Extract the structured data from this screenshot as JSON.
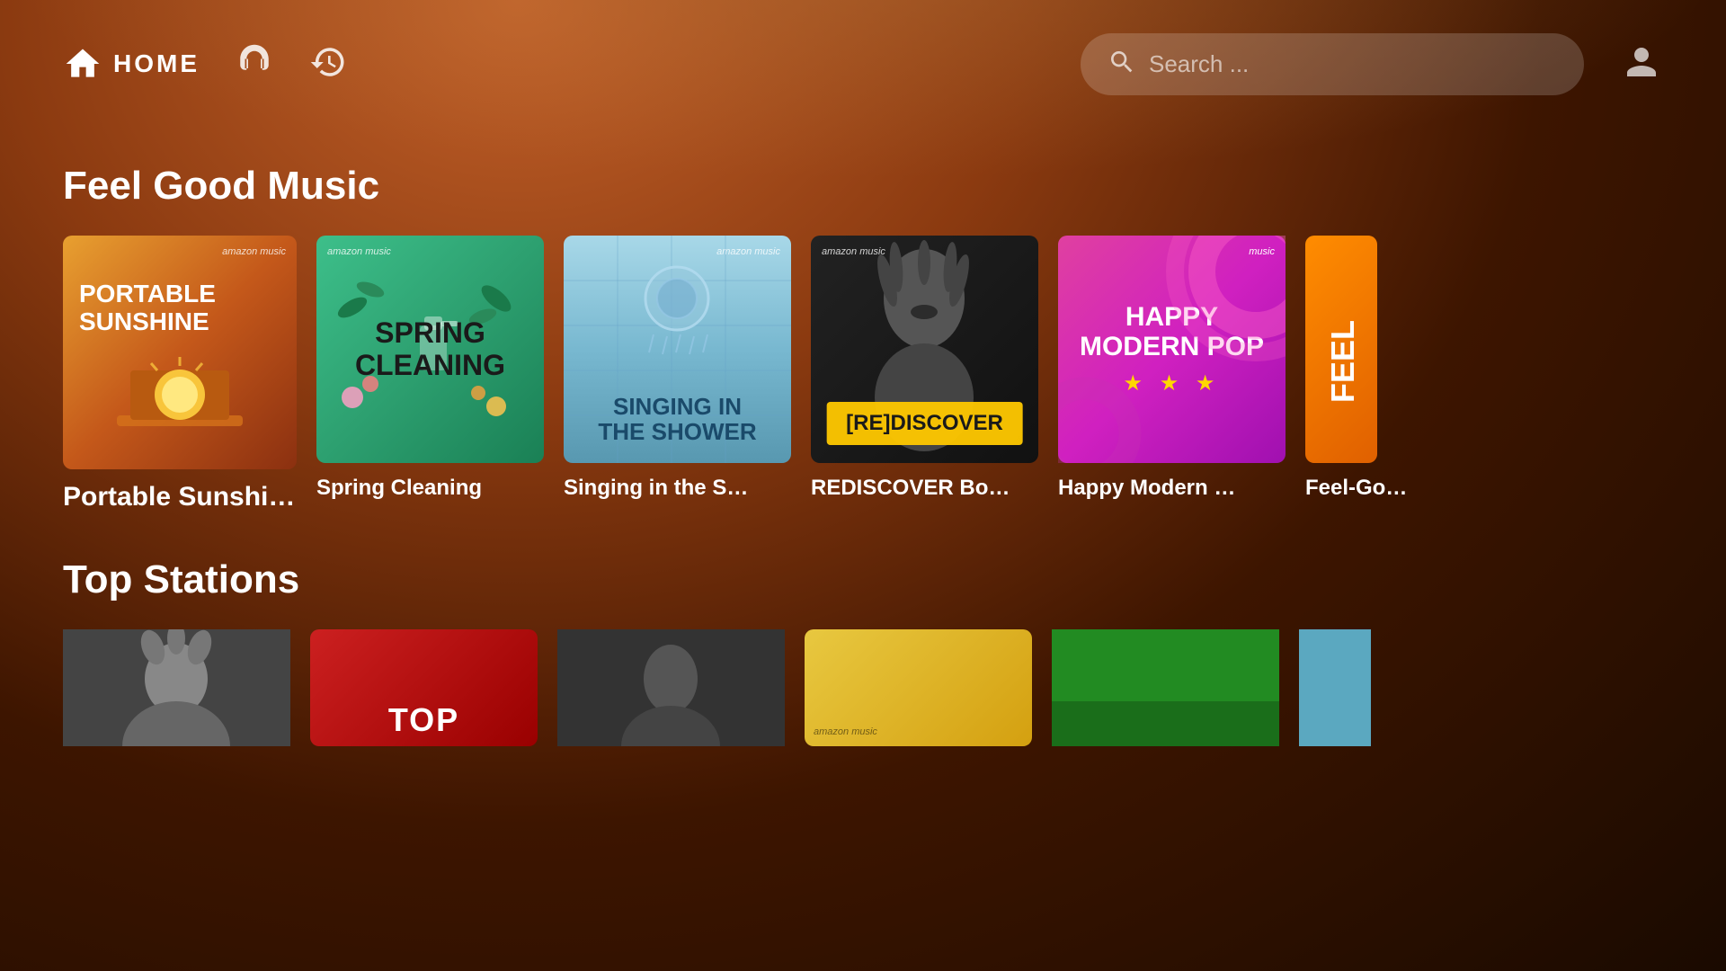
{
  "header": {
    "home_label": "HOME",
    "search_placeholder": "Search ...",
    "search_label": "Search"
  },
  "sections": [
    {
      "id": "feel_good",
      "title": "Feel Good Music",
      "cards": [
        {
          "id": "portable_sunshine",
          "label": "Portable Sunshine",
          "text1": "PORTABLE",
          "text2": "SUNSHINE",
          "bg": "orange"
        },
        {
          "id": "spring_cleaning",
          "label": "Spring Cleaning",
          "text1": "SPRING",
          "text2": "CLEANING",
          "bg": "green"
        },
        {
          "id": "singing_shower",
          "label": "Singing in the S…",
          "text1": "SINGING IN",
          "text2": "THE SHOWER",
          "bg": "blue"
        },
        {
          "id": "rediscover",
          "label": "REDISCOVER Bo…",
          "badge": "[RE]DISCOVER",
          "bg": "dark"
        },
        {
          "id": "happy_modern",
          "label": "Happy Modern …",
          "text1": "HAPPY",
          "text2": "MODERN POP",
          "stars": "★ ★ ★",
          "bg": "pink"
        },
        {
          "id": "feelgood_country",
          "label": "Feel-Go…",
          "bg": "orange2"
        }
      ]
    },
    {
      "id": "top_stations",
      "title": "Top Stations",
      "cards": [
        {
          "id": "station_bw",
          "label": "",
          "bg": "bw"
        },
        {
          "id": "station_top",
          "label": "",
          "text": "ToP",
          "bg": "red"
        },
        {
          "id": "station_dark2",
          "label": "",
          "bg": "dark2"
        },
        {
          "id": "station_yellow",
          "label": "",
          "bg": "yellow"
        },
        {
          "id": "station_green",
          "label": "",
          "bg": "green2"
        },
        {
          "id": "station_blue2",
          "label": "",
          "bg": "blue2"
        }
      ]
    }
  ],
  "amazon_music_text": "amazon music",
  "icons": {
    "home": "home-icon",
    "headphones": "headphones-icon",
    "history": "history-icon",
    "search": "search-icon",
    "user": "user-icon"
  }
}
